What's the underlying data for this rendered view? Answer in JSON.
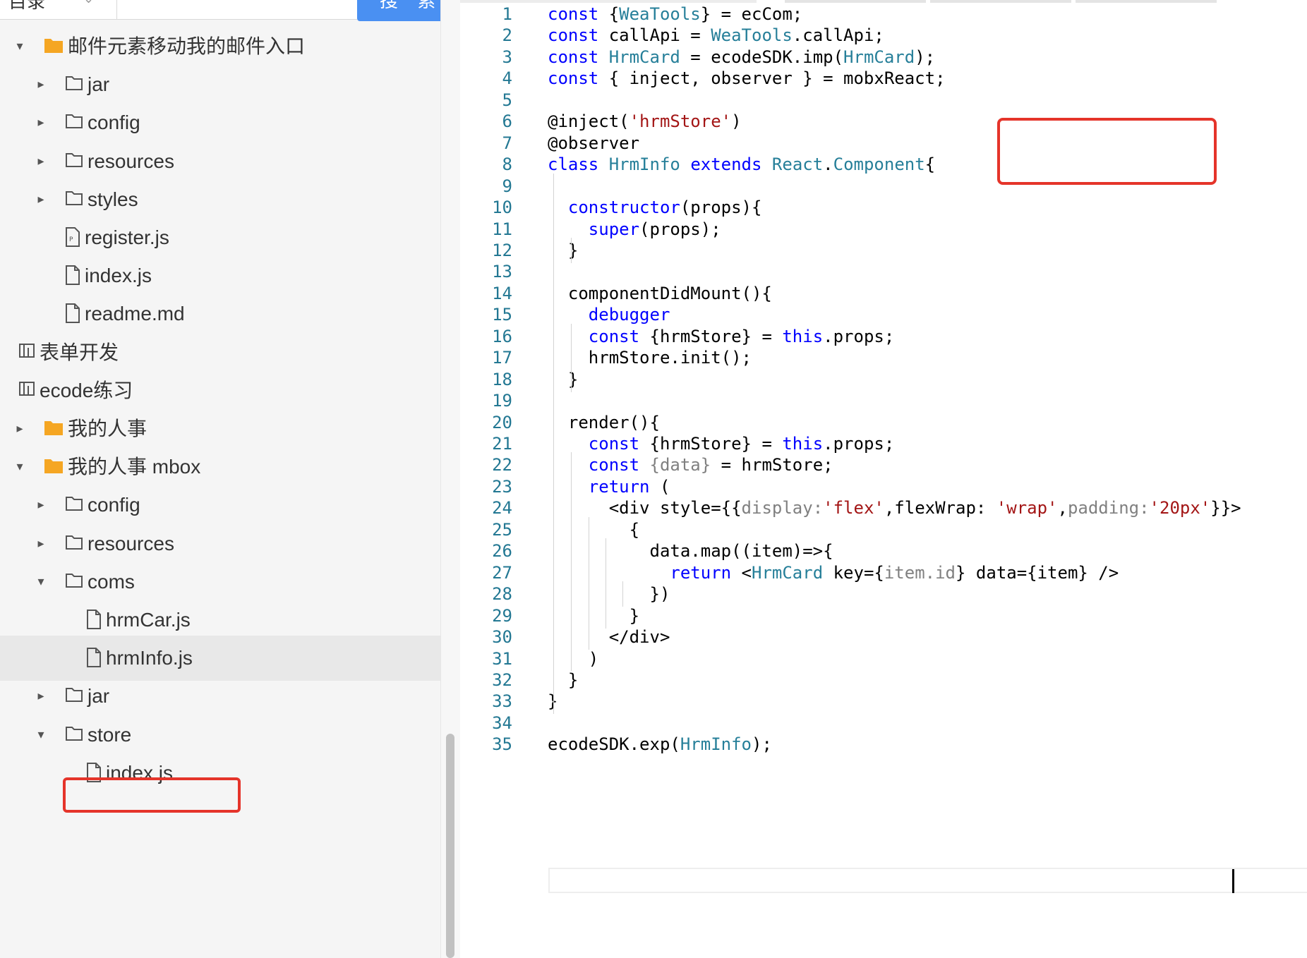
{
  "sidebar": {
    "directory_label": "目录",
    "search_button_label": "搜 索",
    "search_placeholder": "",
    "tree": [
      {
        "label": "邮件元素移动我的邮件入口",
        "type": "folder-filled",
        "expanded": true
      },
      {
        "label": "jar",
        "type": "folder-outline",
        "expanded": false
      },
      {
        "label": "config",
        "type": "folder-outline",
        "expanded": false
      },
      {
        "label": "resources",
        "type": "folder-outline",
        "expanded": false
      },
      {
        "label": "styles",
        "type": "folder-outline",
        "expanded": false
      },
      {
        "label": "register.js",
        "type": "file-p"
      },
      {
        "label": "index.js",
        "type": "file"
      },
      {
        "label": "readme.md",
        "type": "file"
      },
      {
        "label": "表单开发",
        "type": "form-app"
      },
      {
        "label": "ecode练习",
        "type": "form-app"
      },
      {
        "label": "我的人事",
        "type": "folder-filled",
        "expanded": false
      },
      {
        "label": "我的人事 mbox",
        "type": "folder-filled",
        "expanded": true
      },
      {
        "label": "config",
        "type": "folder-outline",
        "expanded": false
      },
      {
        "label": "resources",
        "type": "folder-outline",
        "expanded": false
      },
      {
        "label": "coms",
        "type": "folder-outline",
        "expanded": true
      },
      {
        "label": "hrmCar.js",
        "type": "file"
      },
      {
        "label": "hrmInfo.js",
        "type": "file",
        "selected": true
      },
      {
        "label": "jar",
        "type": "folder-outline",
        "expanded": false
      },
      {
        "label": "store",
        "type": "folder-outline",
        "expanded": true
      },
      {
        "label": "index.js",
        "type": "file"
      }
    ]
  },
  "editor": {
    "line_numbers": [
      "1",
      "2",
      "3",
      "4",
      "5",
      "6",
      "7",
      "8",
      "9",
      "10",
      "11",
      "12",
      "13",
      "14",
      "15",
      "16",
      "17",
      "18",
      "19",
      "20",
      "21",
      "22",
      "23",
      "24",
      "25",
      "26",
      "27",
      "28",
      "29",
      "30",
      "31",
      "32",
      "33",
      "34",
      "35"
    ],
    "lines": [
      "const {WeaTools} = ecCom;",
      "const callApi = WeaTools.callApi;",
      "const HrmCard = ecodeSDK.imp(HrmCard);",
      "const { inject, observer } = mobxReact;",
      "",
      "@inject('hrmStore')",
      "@observer",
      "class HrmInfo extends React.Component{",
      "",
      "  constructor(props){",
      "    super(props);",
      "  }",
      "",
      "  componentDidMount(){",
      "    debugger",
      "    const {hrmStore} = this.props;",
      "    hrmStore.init();",
      "  }",
      "",
      "  render(){",
      "    const {hrmStore} = this.props;",
      "    const {data} = hrmStore;",
      "    return (",
      "      <div style={{display:'flex',flexWrap: 'wrap',padding:'20px'}}>",
      "        {",
      "          data.map((item)=>{",
      "            return <HrmCard key={item.id} data={item} />",
      "          })",
      "        }",
      "      </div>",
      "    )",
      "  }",
      "}",
      "",
      "ecodeSDK.exp(HrmInfo);"
    ],
    "colors": {
      "keyword": "#0000ff",
      "type": "#267f99",
      "string": "#a31515",
      "line_number": "#237893",
      "highlight": "#e5342a"
    }
  }
}
